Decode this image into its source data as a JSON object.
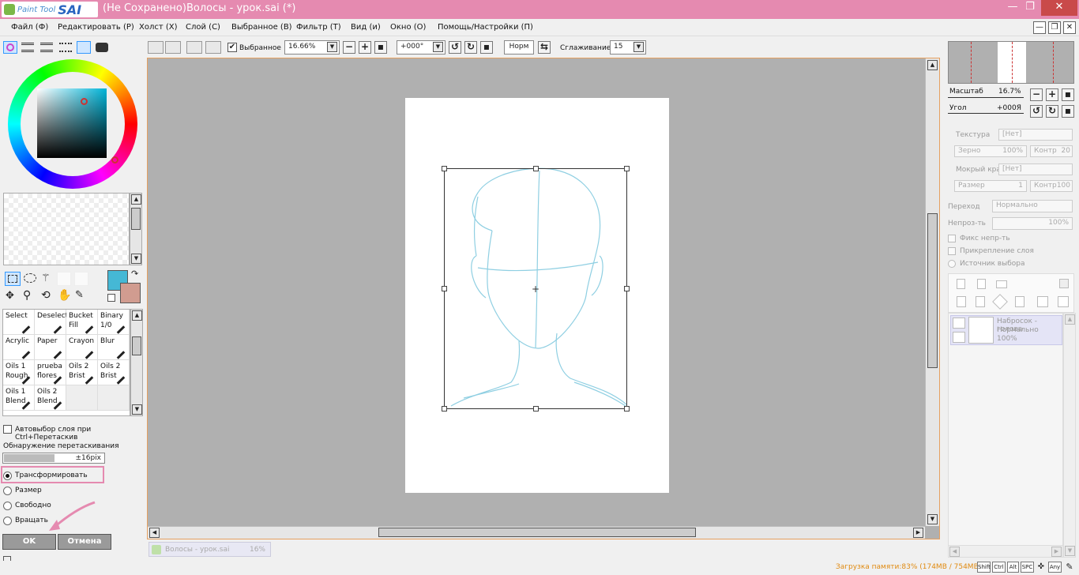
{
  "app": {
    "logo_small": "Paint Tool",
    "logo_big": "SAI",
    "title": "(Не Сохранено)Волосы - урок.sai (*)"
  },
  "window_buttons": {
    "minimize": "—",
    "restore": "❐",
    "close": "✕"
  },
  "menu": [
    "Файл (Ф)",
    "Редактировать (Р)",
    "Холст (Х)",
    "Слой (С)",
    "Выбранное (В)",
    "Фильтр (Т)",
    "Вид (и)",
    "Окно (О)",
    "Помощь/Настройки (П)"
  ],
  "toolbar": {
    "selection_label": "Выбранное",
    "zoom_value": "16.66%",
    "angle_value": "+000°",
    "norm_label": "Норм",
    "smoothing_label": "Сглаживание",
    "smoothing_value": "15"
  },
  "colors": {
    "title_bar": "#e58ab0",
    "canvas_bg": "#b0b0b0",
    "primary_color": "#45b8d5",
    "secondary_color": "#d19c90",
    "memory_text": "#e08a10",
    "sketch": "#8fcfe2"
  },
  "tools": [
    {
      "label": "Select",
      "icon": "select-icon"
    },
    {
      "label": "Deselect",
      "icon": "deselect-icon"
    },
    {
      "label": "Bucket Fill",
      "icon": "bucket-icon"
    },
    {
      "label": "Binary 1/0",
      "icon": "pencil-icon"
    },
    {
      "label": "Acrylic",
      "icon": "brush-icon"
    },
    {
      "label": "Paper",
      "icon": "brush-icon"
    },
    {
      "label": "Crayon",
      "icon": "brush-icon"
    },
    {
      "label": "Blur",
      "icon": "blur-icon"
    },
    {
      "label": "Oils 1 Rough",
      "icon": "brush-icon"
    },
    {
      "label": "prueba flores",
      "icon": "brush-icon"
    },
    {
      "label": "Oils 2 Brist",
      "icon": "brush-icon"
    },
    {
      "label": "Oils 2 Brist",
      "icon": "brush-icon"
    },
    {
      "label": "Oils 1 Blend",
      "icon": "brush-icon"
    },
    {
      "label": "Oils 2 Blend",
      "icon": "brush-icon"
    }
  ],
  "tool_options": {
    "autoselect_label": "Автовыбор слоя при Ctrl+Перетаскив",
    "drag_detect_label": "Обнаружение перетаскивания",
    "drag_detect_value": "±16pix",
    "modes": [
      "Трансформировать",
      "Размер",
      "Свободно",
      "Вращать"
    ],
    "selected_mode": "Трансформировать",
    "ok_label": "OK",
    "cancel_label": "Отмена"
  },
  "navigator": {
    "scale_label": "Масштаб",
    "scale_value": "16.7%",
    "angle_label": "Угол",
    "angle_value": "+000Я"
  },
  "layer_props": {
    "texture_label": "Текстура",
    "texture_value": "[Нет]",
    "grain_label": "Зерно",
    "grain_value": "100%",
    "contrast1_label": "Контр",
    "contrast1_value": "20",
    "wet_edge_label": "Мокрый край",
    "wet_edge_value": "[Нет]",
    "size_label": "Размер",
    "size_value": "1",
    "contrast2_label": "Контр",
    "contrast2_value": "100",
    "blend_label": "Переход",
    "blend_value": "Нормально",
    "opacity_label": "Непроз-ть",
    "opacity_value": "100%",
    "fix_opacity": "Фикс непр-ть",
    "clip_layer": "Прикрепление слоя",
    "selection_source": "Источник выбора"
  },
  "layers": [
    {
      "name": "Набросок - голова",
      "mode": "Нормально",
      "opacity": "100%"
    }
  ],
  "document_tab": {
    "name": "Волосы - урок.sai",
    "zoom": "16%"
  },
  "status": {
    "memory": "Загрузка памяти:83% (174MB / 754MB)",
    "keys": [
      "Shift",
      "Ctrl",
      "Alt",
      "SPC",
      "Any"
    ]
  }
}
